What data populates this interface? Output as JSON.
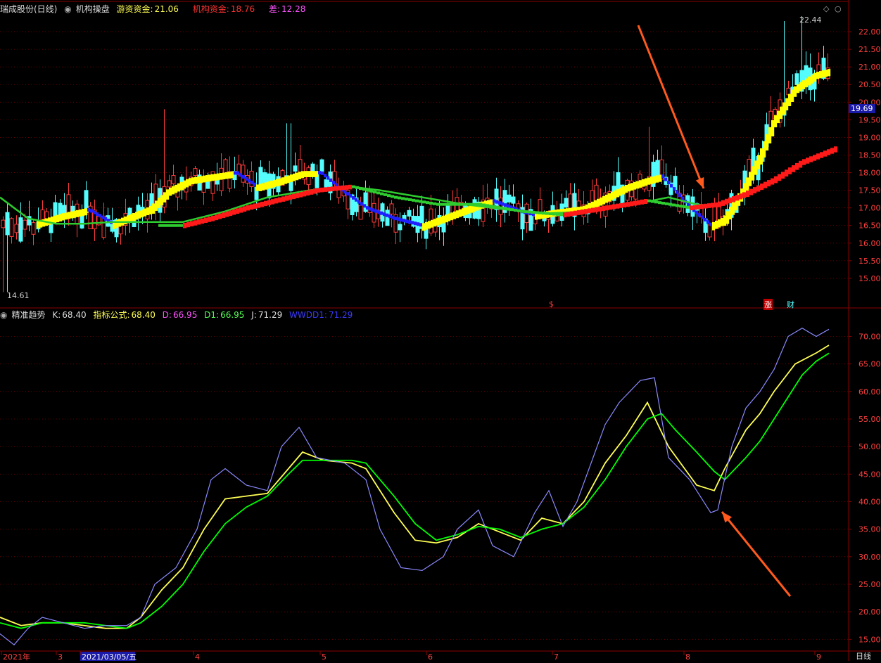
{
  "colors": {
    "bg": "#000000",
    "frame": "#8b0000",
    "grid": "#7a0000",
    "up": "#ff3c3c",
    "down": "#54fcfc",
    "yellow": "#ffff00",
    "red": "#ff1a1a",
    "green": "#2ecc2e",
    "blue": "#1e1eff",
    "k": "#ffff54",
    "d": "#00ff00",
    "j": "#8a8aff",
    "arrow": "#ff5a1e"
  },
  "header_top": {
    "stock": "瑞成股份(日线)",
    "indicator": "机构操盘",
    "hot_money_label": "游资资金:",
    "hot_money_value": "21.06",
    "inst_label": "机构资金:",
    "inst_value": "18.76",
    "diff_label": "差:",
    "diff_value": "12.28"
  },
  "header_bottom": {
    "indicator": "精准趋势",
    "k_label": "K:",
    "k_value": "68.40",
    "formula_label": "指标公式:",
    "formula_value": "68.40",
    "d_label": "D:",
    "d_value": "66.95",
    "d1_label": "D1:",
    "d1_value": "66.95",
    "j_label": "J:",
    "j_value": "71.29",
    "wwd_label": "WWDD1:",
    "wwd_value": "71.29"
  },
  "price_panel": {
    "ylim": [
      14.4,
      22.5
    ],
    "ticks": [
      "15.00",
      "15.50",
      "16.00",
      "16.50",
      "17.00",
      "17.50",
      "18.00",
      "18.50",
      "19.00",
      "19.50",
      "20.00",
      "20.50",
      "21.00",
      "21.50",
      "22.00"
    ],
    "current_price": "19.69",
    "high_label": "22.44",
    "low_label": "14.61",
    "markers": [
      "$",
      "涨",
      "财"
    ]
  },
  "osc_panel": {
    "ylim": [
      13.0,
      73.0
    ],
    "ticks": [
      "15.00",
      "20.00",
      "25.00",
      "30.00",
      "35.00",
      "40.00",
      "45.00",
      "50.00",
      "55.00",
      "60.00",
      "65.00",
      "70.00"
    ]
  },
  "x_axis": {
    "labels": [
      "2021年",
      "3",
      "2021/03/05/五",
      "4",
      "5",
      "6",
      "7",
      "8",
      "9"
    ],
    "right_label": "日线"
  },
  "chart_data": [
    {
      "type": "candlestick",
      "ylim": [
        14.4,
        22.5
      ],
      "ma_fast_yellow": [
        [
          50,
          16.55
        ],
        [
          90,
          16.8
        ],
        [
          125,
          16.95
        ],
        [
          160,
          16.55
        ],
        [
          190,
          16.8
        ],
        [
          215,
          17.0
        ],
        [
          240,
          17.5
        ],
        [
          270,
          17.8
        ],
        [
          300,
          17.9
        ],
        [
          335,
          18.0
        ],
        [
          365,
          17.6
        ],
        [
          400,
          17.8
        ],
        [
          430,
          18.0
        ],
        [
          455,
          18.0
        ],
        [
          485,
          17.5
        ],
        [
          520,
          17.0
        ],
        [
          560,
          16.7
        ],
        [
          600,
          16.5
        ],
        [
          640,
          16.8
        ],
        [
          680,
          17.1
        ],
        [
          700,
          17.2
        ],
        [
          740,
          16.9
        ],
        [
          760,
          16.8
        ],
        [
          790,
          16.9
        ],
        [
          830,
          17.0
        ],
        [
          860,
          17.3
        ],
        [
          890,
          17.6
        ],
        [
          920,
          17.8
        ],
        [
          940,
          17.9
        ],
        [
          980,
          17.0
        ],
        [
          1010,
          16.5
        ],
        [
          1030,
          16.7
        ],
        [
          1055,
          17.5
        ],
        [
          1080,
          18.5
        ],
        [
          1100,
          19.5
        ],
        [
          1130,
          20.4
        ],
        [
          1160,
          20.8
        ],
        [
          1180,
          20.9
        ]
      ],
      "ma_mid_red": [
        [
          225,
          16.5
        ],
        [
          260,
          16.5
        ],
        [
          300,
          16.7
        ],
        [
          350,
          17.0
        ],
        [
          400,
          17.25
        ],
        [
          450,
          17.5
        ],
        [
          500,
          17.6
        ],
        [
          560,
          17.3
        ],
        [
          620,
          17.1
        ],
        [
          680,
          17.1
        ],
        [
          740,
          16.9
        ],
        [
          800,
          16.8
        ],
        [
          860,
          17.0
        ],
        [
          920,
          17.2
        ],
        [
          980,
          17.0
        ],
        [
          1020,
          17.1
        ],
        [
          1060,
          17.4
        ],
        [
          1100,
          17.8
        ],
        [
          1140,
          18.3
        ],
        [
          1190,
          18.7
        ]
      ],
      "ma_slow_green": [
        [
          0,
          17.3
        ],
        [
          40,
          16.7
        ],
        [
          80,
          16.55
        ],
        [
          120,
          16.55
        ],
        [
          160,
          16.6
        ],
        [
          200,
          16.6
        ],
        [
          260,
          16.6
        ],
        [
          320,
          16.9
        ],
        [
          380,
          17.3
        ],
        [
          440,
          17.5
        ],
        [
          500,
          17.6
        ],
        [
          540,
          17.5
        ],
        [
          600,
          17.3
        ],
        [
          660,
          17.1
        ],
        [
          720,
          16.95
        ],
        [
          780,
          16.85
        ],
        [
          840,
          16.9
        ],
        [
          900,
          17.1
        ],
        [
          950,
          17.3
        ],
        [
          990,
          17.1
        ],
        [
          1010,
          17.05
        ]
      ],
      "candles_sampled": "rendered procedurally from envelope of price trend"
    },
    {
      "type": "line",
      "ylim": [
        13.0,
        73.0
      ],
      "series": [
        {
          "name": "K",
          "points": [
            [
              0,
              19
            ],
            [
              30,
              17.5
            ],
            [
              60,
              18
            ],
            [
              90,
              18
            ],
            [
              120,
              17.5
            ],
            [
              150,
              17
            ],
            [
              180,
              17
            ],
            [
              200,
              19
            ],
            [
              230,
              24
            ],
            [
              260,
              28
            ],
            [
              290,
              35
            ],
            [
              320,
              40.5
            ],
            [
              350,
              41
            ],
            [
              380,
              41.5
            ],
            [
              410,
              46
            ],
            [
              430,
              49
            ],
            [
              460,
              47.5
            ],
            [
              500,
              47
            ],
            [
              520,
              46
            ],
            [
              560,
              38
            ],
            [
              590,
              33
            ],
            [
              620,
              32.5
            ],
            [
              650,
              33.5
            ],
            [
              680,
              36
            ],
            [
              710,
              34.5
            ],
            [
              740,
              33
            ],
            [
              770,
              37
            ],
            [
              800,
              36
            ],
            [
              830,
              40
            ],
            [
              860,
              47
            ],
            [
              890,
              52
            ],
            [
              920,
              58
            ],
            [
              950,
              50
            ],
            [
              990,
              43
            ],
            [
              1015,
              42
            ],
            [
              1030,
              46
            ],
            [
              1060,
              53
            ],
            [
              1080,
              56
            ],
            [
              1100,
              60
            ],
            [
              1130,
              65
            ],
            [
              1160,
              67
            ],
            [
              1178,
              68.4
            ]
          ]
        },
        {
          "name": "D",
          "points": [
            [
              0,
              18
            ],
            [
              30,
              17
            ],
            [
              60,
              18
            ],
            [
              90,
              18
            ],
            [
              120,
              18
            ],
            [
              150,
              17.5
            ],
            [
              180,
              17
            ],
            [
              200,
              18
            ],
            [
              230,
              21
            ],
            [
              260,
              25
            ],
            [
              290,
              31
            ],
            [
              320,
              36
            ],
            [
              350,
              39
            ],
            [
              380,
              41
            ],
            [
              410,
              45
            ],
            [
              430,
              47.5
            ],
            [
              460,
              47.5
            ],
            [
              500,
              47.5
            ],
            [
              520,
              47
            ],
            [
              560,
              41
            ],
            [
              590,
              36
            ],
            [
              620,
              33
            ],
            [
              650,
              34
            ],
            [
              680,
              35.5
            ],
            [
              710,
              35
            ],
            [
              740,
              33.5
            ],
            [
              770,
              35
            ],
            [
              800,
              36
            ],
            [
              830,
              39
            ],
            [
              860,
              44
            ],
            [
              890,
              50
            ],
            [
              920,
              55
            ],
            [
              940,
              56
            ],
            [
              960,
              53
            ],
            [
              990,
              49
            ],
            [
              1015,
              45.5
            ],
            [
              1030,
              44
            ],
            [
              1060,
              48
            ],
            [
              1080,
              51
            ],
            [
              1110,
              57
            ],
            [
              1140,
              63
            ],
            [
              1160,
              65.5
            ],
            [
              1178,
              66.95
            ]
          ]
        },
        {
          "name": "WWDD1",
          "points": [
            [
              0,
              16
            ],
            [
              20,
              14
            ],
            [
              40,
              17
            ],
            [
              60,
              19
            ],
            [
              90,
              18
            ],
            [
              120,
              17
            ],
            [
              150,
              17.5
            ],
            [
              180,
              17.5
            ],
            [
              200,
              19
            ],
            [
              220,
              25
            ],
            [
              250,
              28
            ],
            [
              280,
              35
            ],
            [
              300,
              44
            ],
            [
              320,
              46
            ],
            [
              350,
              43
            ],
            [
              380,
              42
            ],
            [
              400,
              50
            ],
            [
              425,
              53.5
            ],
            [
              450,
              48
            ],
            [
              490,
              47
            ],
            [
              520,
              44
            ],
            [
              540,
              35
            ],
            [
              570,
              28
            ],
            [
              600,
              27.5
            ],
            [
              630,
              30
            ],
            [
              650,
              35
            ],
            [
              680,
              38.5
            ],
            [
              700,
              32
            ],
            [
              730,
              30
            ],
            [
              760,
              38
            ],
            [
              780,
              42
            ],
            [
              800,
              35.5
            ],
            [
              820,
              40
            ],
            [
              860,
              54
            ],
            [
              880,
              58
            ],
            [
              910,
              62
            ],
            [
              930,
              62.5
            ],
            [
              950,
              48
            ],
            [
              980,
              44
            ],
            [
              1010,
              38
            ],
            [
              1020,
              38.5
            ],
            [
              1040,
              50
            ],
            [
              1060,
              57
            ],
            [
              1080,
              60
            ],
            [
              1100,
              64
            ],
            [
              1120,
              70
            ],
            [
              1140,
              71.5
            ],
            [
              1160,
              70
            ],
            [
              1178,
              71.3
            ]
          ]
        }
      ]
    }
  ]
}
